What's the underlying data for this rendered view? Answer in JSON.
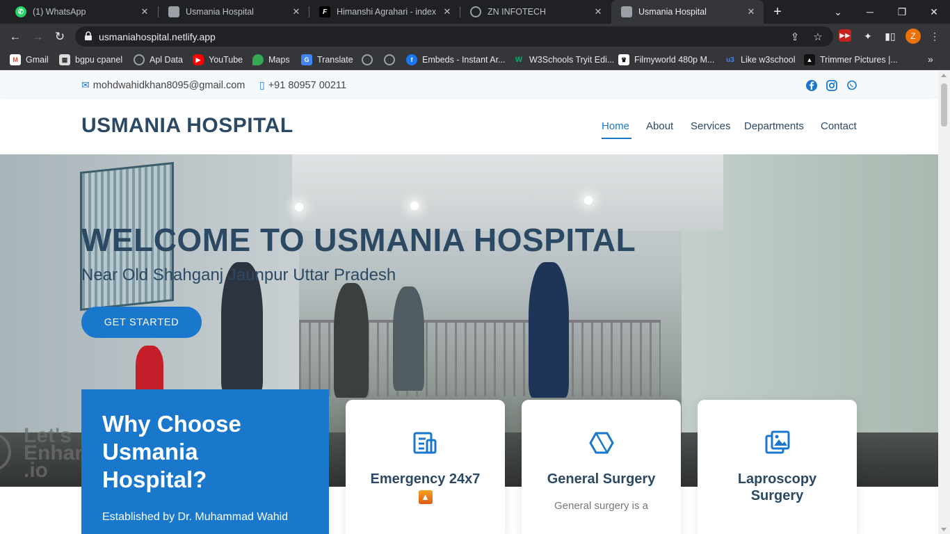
{
  "browser": {
    "tabs": [
      {
        "title": "(1) WhatsApp",
        "active": false
      },
      {
        "title": "Usmania Hospital",
        "active": false
      },
      {
        "title": "Himanshi Agrahari - index",
        "active": false
      },
      {
        "title": "ZN INFOTECH",
        "active": false
      },
      {
        "title": "Usmania Hospital",
        "active": true
      }
    ],
    "url": "usmaniahospital.netlify.app",
    "profile_initial": "Z",
    "bookmarks": [
      "Gmail",
      "bgpu cpanel",
      "Apl Data",
      "YouTube",
      "Maps",
      "Translate",
      "Embeds - Instant Ar...",
      "W3Schools Tryit Edi...",
      "Filmyworld 480p M...",
      "Like w3school",
      "Trimmer Pictures |..."
    ]
  },
  "site": {
    "topbar": {
      "email": "mohdwahidkhan8095@gmail.com",
      "phone": "+91 80957 00211"
    },
    "logo": "USMANIA HOSPITAL",
    "nav": [
      "Home",
      "About",
      "Services",
      "Departments",
      "Contact"
    ],
    "hero": {
      "title": "WELCOME TO USMANIA HOSPITAL",
      "subtitle": "Near Old Shahganj Jaunpur Uttar Pradesh",
      "cta": "GET STARTED",
      "watermark": [
        "Let's",
        "Enhan",
        ".io"
      ]
    },
    "why": {
      "title": "Why Choose Usmania Hospital?",
      "text": "Established by Dr. Muhammad Wahid"
    },
    "icon_boxes": [
      {
        "title": "Emergency 24x7",
        "text": "",
        "icon": "file-list-icon"
      },
      {
        "title": "General Surgery",
        "text": "General surgery is a",
        "icon": "hexagon-icon"
      },
      {
        "title": "Laproscopy Surgery",
        "text": "",
        "icon": "images-icon"
      }
    ]
  },
  "colors": {
    "primary": "#1977cc",
    "heading": "#2c4964",
    "chrome_dark": "#202124",
    "chrome_mid": "#35363a"
  }
}
